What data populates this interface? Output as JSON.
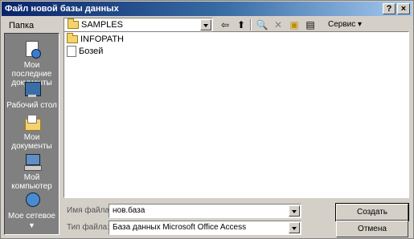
{
  "window": {
    "title": "Файл новой базы данных",
    "help_glyph": "?",
    "close_glyph": "×"
  },
  "lookin": {
    "label": "Папка",
    "value": "SAMPLES"
  },
  "toolbar": {
    "back_glyph": "⇦",
    "up_glyph": "⬆",
    "search_glyph": "🔍",
    "delete_glyph": "✕",
    "newfolder_glyph": "▣",
    "views_glyph": "▤",
    "tools_label": "Сервис ▾"
  },
  "places": [
    {
      "label": "Мои последние документы",
      "icon": "recent-documents-icon"
    },
    {
      "label": "Рабочий стол",
      "icon": "desktop-icon"
    },
    {
      "label": "Мои документы",
      "icon": "my-documents-icon"
    },
    {
      "label": "Мой компьютер",
      "icon": "my-computer-icon"
    },
    {
      "label": "Мое сетевое",
      "icon": "network-icon"
    }
  ],
  "files": [
    {
      "name": "INFOPATH",
      "type": "folder"
    },
    {
      "name": "Бозей",
      "type": "file"
    }
  ],
  "filename": {
    "label": "Имя файла:",
    "value": "нов.база"
  },
  "filetype": {
    "label": "Тип файла:",
    "value": "База данных Microsoft Office Access"
  },
  "buttons": {
    "create": "Создать",
    "cancel": "Отмена"
  },
  "colors": {
    "title_start": "#0a246a",
    "title_end": "#a6caf0",
    "face": "#d4d0c8"
  }
}
